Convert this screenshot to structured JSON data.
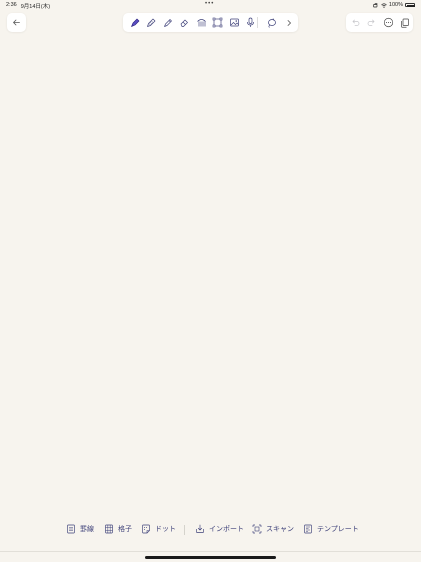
{
  "status_bar": {
    "time": "2:36",
    "date": "9月14日(木)",
    "dots": "•••",
    "battery_percent": "100%",
    "battery_level": 1.0
  },
  "toolbar": {
    "tools": [
      {
        "name": "fountain-pen-icon",
        "active": true
      },
      {
        "name": "pencil-icon",
        "active": false
      },
      {
        "name": "marker-icon",
        "active": false
      },
      {
        "name": "eraser-icon",
        "active": false
      },
      {
        "name": "shape-icon",
        "active": false
      },
      {
        "name": "selection-icon",
        "active": false
      },
      {
        "name": "image-icon",
        "active": false
      },
      {
        "name": "microphone-icon",
        "active": false
      },
      {
        "name": "lasso-icon",
        "active": false
      },
      {
        "name": "chevron-right-icon",
        "active": false
      }
    ]
  },
  "right_toolbar": {
    "items": [
      "undo-icon",
      "redo-icon",
      "more-icon",
      "pages-icon"
    ]
  },
  "bottom_options": [
    {
      "label": "罫線",
      "icon": "ruled-paper-icon"
    },
    {
      "label": "格子",
      "icon": "grid-paper-icon"
    },
    {
      "label": "ドット",
      "icon": "dot-paper-icon"
    },
    {
      "label": "インポート",
      "icon": "import-icon"
    },
    {
      "label": "スキャン",
      "icon": "scan-icon"
    },
    {
      "label": "テンプレート",
      "icon": "template-icon"
    }
  ],
  "colors": {
    "background": "#f7f4ee",
    "accent": "#3c3f78",
    "active_tool": "#4a3fb0"
  }
}
